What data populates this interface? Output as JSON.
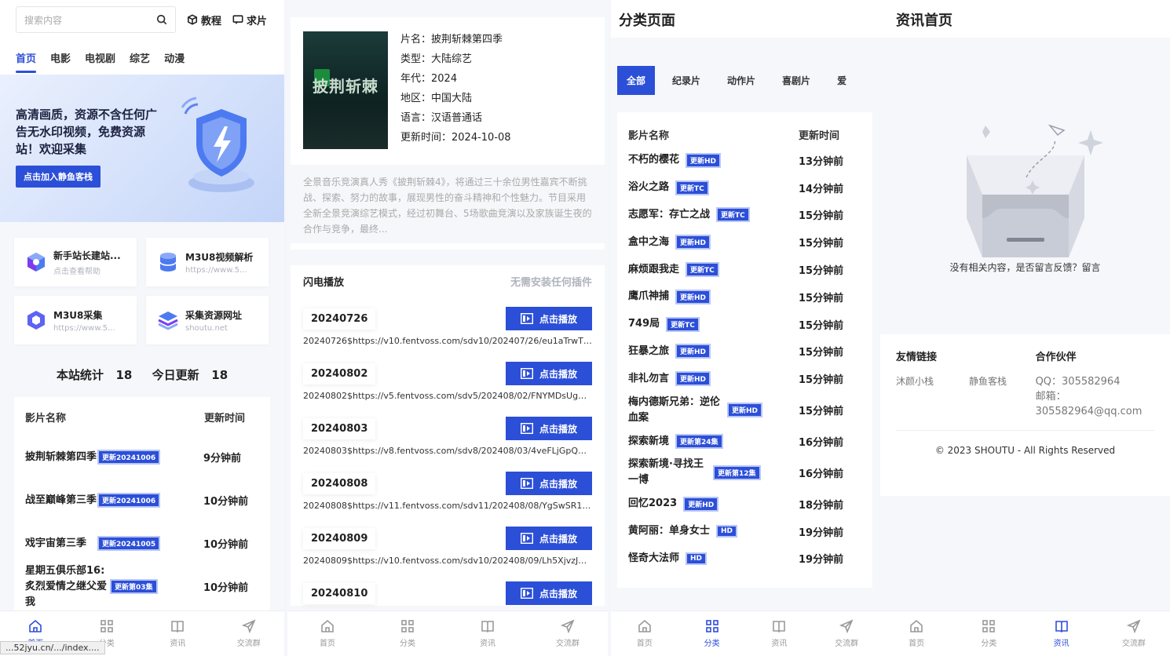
{
  "nav_bottom": {
    "home": "首页",
    "category": "分类",
    "news": "资讯",
    "group": "交流群"
  },
  "p1": {
    "search_placeholder": "搜索内容",
    "link_tutorial": "教程",
    "link_request": "求片",
    "tabs": [
      "首页",
      "电影",
      "电视剧",
      "综艺",
      "动漫"
    ],
    "banner_text": "高清画质，资源不含任何广告无水印视频，免费资源站！欢迎采集",
    "banner_btn": "点击加入静鱼客栈",
    "cards": [
      {
        "title": "新手站长建站...",
        "sub": "点击查看帮助"
      },
      {
        "title": "M3U8视频解析",
        "sub": "https://www.5..."
      },
      {
        "title": "M3U8采集",
        "sub": "https://www.5..."
      },
      {
        "title": "采集资源网址",
        "sub": "shoutu.net"
      }
    ],
    "stats_total_label": "本站统计",
    "stats_total": "18",
    "stats_today_label": "今日更新",
    "stats_today": "18",
    "list_col_name": "影片名称",
    "list_col_time": "更新时间",
    "rows": [
      {
        "name": "披荆斩棘第四季",
        "badge": "更新20241006",
        "time": "9分钟前"
      },
      {
        "name": "战至巅峰第三季",
        "badge": "更新20241006",
        "time": "10分钟前"
      },
      {
        "name": "戏宇宙第三季",
        "badge": "更新20241005",
        "time": "10分钟前"
      },
      {
        "name": "星期五俱乐部16:炙烈爱情之继父爱我",
        "badge": "更新第03集",
        "time": "10分钟前"
      }
    ],
    "url_tip": "...52jyu.cn/.../index...."
  },
  "p2": {
    "title_label": "片名：",
    "title": "披荆斩棘第四季",
    "type_label": "类型：",
    "type": "大陆综艺",
    "year_label": "年代：",
    "year": "2024",
    "area_label": "地区：",
    "area": "中国大陆",
    "lang_label": "语言：",
    "lang": "汉语普通话",
    "updated_label": "更新时间：",
    "updated": "2024-10-08",
    "poster_text": "披荆斩棘",
    "desc": "全景音乐竞演真人秀《披荆斩棘4》，将通过三十余位男性嘉宾不断挑战、探索、努力的故事，展现男性的奋斗精神和个性魅力。节目采用全新全景竞演综艺模式，经过初舞台、5场歌曲竞演以及家族诞生夜的合作与竞争，最终...",
    "play_source": "闪电播放",
    "play_note": "无需安装任何插件",
    "play_btn": "点击播放",
    "episodes": [
      {
        "name": "20240726",
        "url": "20240726$https://v10.fentvoss.com/sdv10/202407/26/eu1aTrwTB91..."
      },
      {
        "name": "20240802",
        "url": "20240802$https://v5.fentvoss.com/sdv5/202408/02/FNYMDsUggs7/..."
      },
      {
        "name": "20240803",
        "url": "20240803$https://v8.fentvoss.com/sdv8/202408/03/4veFLjGpQA14/..."
      },
      {
        "name": "20240808",
        "url": "20240808$https://v11.fentvoss.com/sdv11/202408/08/YgSwSR1KXj3..."
      },
      {
        "name": "20240809",
        "url": "20240809$https://v10.fentvoss.com/sdv10/202408/09/Lh5XjvzJZx15/..."
      },
      {
        "name": "20240810",
        "url": ""
      }
    ]
  },
  "p3": {
    "title": "分类页面",
    "tabs": [
      "全部",
      "纪录片",
      "动作片",
      "喜剧片",
      "爱"
    ],
    "col_name": "影片名称",
    "col_time": "更新时间",
    "rows": [
      {
        "name": "不朽的樱花",
        "badge": "更新HD",
        "time": "13分钟前"
      },
      {
        "name": "浴火之路",
        "badge": "更新TC",
        "time": "14分钟前"
      },
      {
        "name": "志愿军：存亡之战",
        "badge": "更新TC",
        "time": "15分钟前"
      },
      {
        "name": "盒中之海",
        "badge": "更新HD",
        "time": "15分钟前"
      },
      {
        "name": "麻烦跟我走",
        "badge": "更新TC",
        "time": "15分钟前"
      },
      {
        "name": "鹰爪神捕",
        "badge": "更新HD",
        "time": "15分钟前"
      },
      {
        "name": "749局",
        "badge": "更新TC",
        "time": "15分钟前"
      },
      {
        "name": "狂暴之旅",
        "badge": "更新HD",
        "time": "15分钟前"
      },
      {
        "name": "非礼勿言",
        "badge": "更新HD",
        "time": "15分钟前"
      },
      {
        "name": "梅内德斯兄弟：逆伦血案",
        "badge": "更新HD",
        "time": "15分钟前"
      },
      {
        "name": "探索新境",
        "badge": "更新第24集",
        "time": "16分钟前"
      },
      {
        "name": "探索新境·寻找王一博",
        "badge": "更新第12集",
        "time": "16分钟前"
      },
      {
        "name": "回忆2023",
        "badge": "更新HD",
        "time": "18分钟前"
      },
      {
        "name": "黄阿丽：单身女士",
        "badge": "HD",
        "time": "19分钟前"
      },
      {
        "name": "怪奇大法师",
        "badge": "HD",
        "time": "19分钟前"
      }
    ]
  },
  "p4": {
    "title": "资讯首页",
    "empty_text": "没有相关内容，是否留言反馈？留言",
    "links_title": "友情链接",
    "links": [
      "沐颜小栈",
      "静鱼客栈"
    ],
    "partner_title": "合作伙伴",
    "qq": "QQ：305582964",
    "email": "邮箱：305582964@qq.com",
    "copyright": "© 2023 SHOUTU - All Rights Reserved"
  },
  "colors": {
    "accent": "#2c4fd8"
  }
}
